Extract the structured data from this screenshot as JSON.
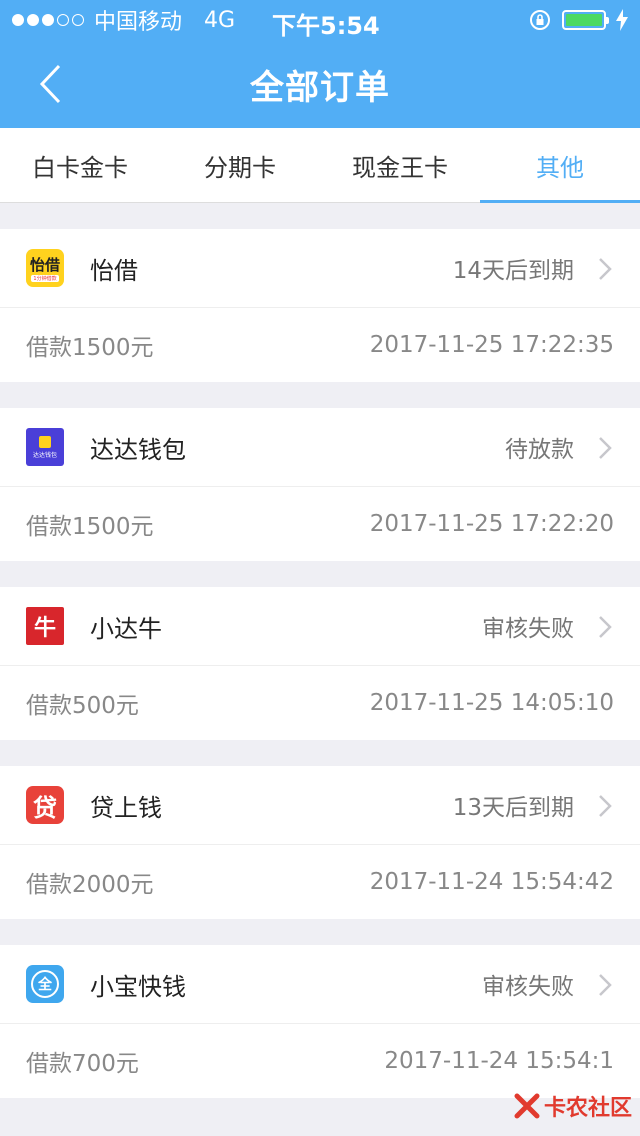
{
  "status_bar": {
    "carrier": "中国移动",
    "network": "4G",
    "time": "下午5:54"
  },
  "nav": {
    "title": "全部订单"
  },
  "tabs": [
    {
      "label": "白卡金卡",
      "active": false
    },
    {
      "label": "分期卡",
      "active": false
    },
    {
      "label": "现金王卡",
      "active": false
    },
    {
      "label": "其他",
      "active": true
    }
  ],
  "orders": [
    {
      "name": "怡借",
      "logo_text": "怡借",
      "logo_sub": "1分钟借款",
      "logo_bg": "#ffd21e",
      "logo_fg": "#222",
      "status": "14天后到期",
      "amount": "借款1500元",
      "datetime": "2017-11-25 17:22:35"
    },
    {
      "name": "达达钱包",
      "logo_text": "",
      "logo_sub": "达达钱包",
      "logo_bg": "#4a3fd8",
      "logo_fg": "#fff",
      "status": "待放款",
      "amount": "借款1500元",
      "datetime": "2017-11-25 17:22:20"
    },
    {
      "name": "小达牛",
      "logo_text": "牛",
      "logo_sub": "",
      "logo_bg": "#d8262c",
      "logo_fg": "#fff",
      "status": "审核失败",
      "amount": "借款500元",
      "datetime": "2017-11-25 14:05:10"
    },
    {
      "name": "贷上钱",
      "logo_text": "贷",
      "logo_sub": "",
      "logo_bg": "#e8423a",
      "logo_fg": "#fff",
      "status": "13天后到期",
      "amount": "借款2000元",
      "datetime": "2017-11-24 15:54:42"
    },
    {
      "name": "小宝快钱",
      "logo_text": "全",
      "logo_sub": "",
      "logo_bg": "#3fa7ee",
      "logo_fg": "#fff",
      "status": "审核失败",
      "amount": "借款700元",
      "datetime": "2017-11-24 15:54:1"
    }
  ],
  "watermark": {
    "text": "卡农社区"
  },
  "colors": {
    "header": "#52aef5",
    "accent": "#52aef5",
    "background": "#efeff4"
  }
}
